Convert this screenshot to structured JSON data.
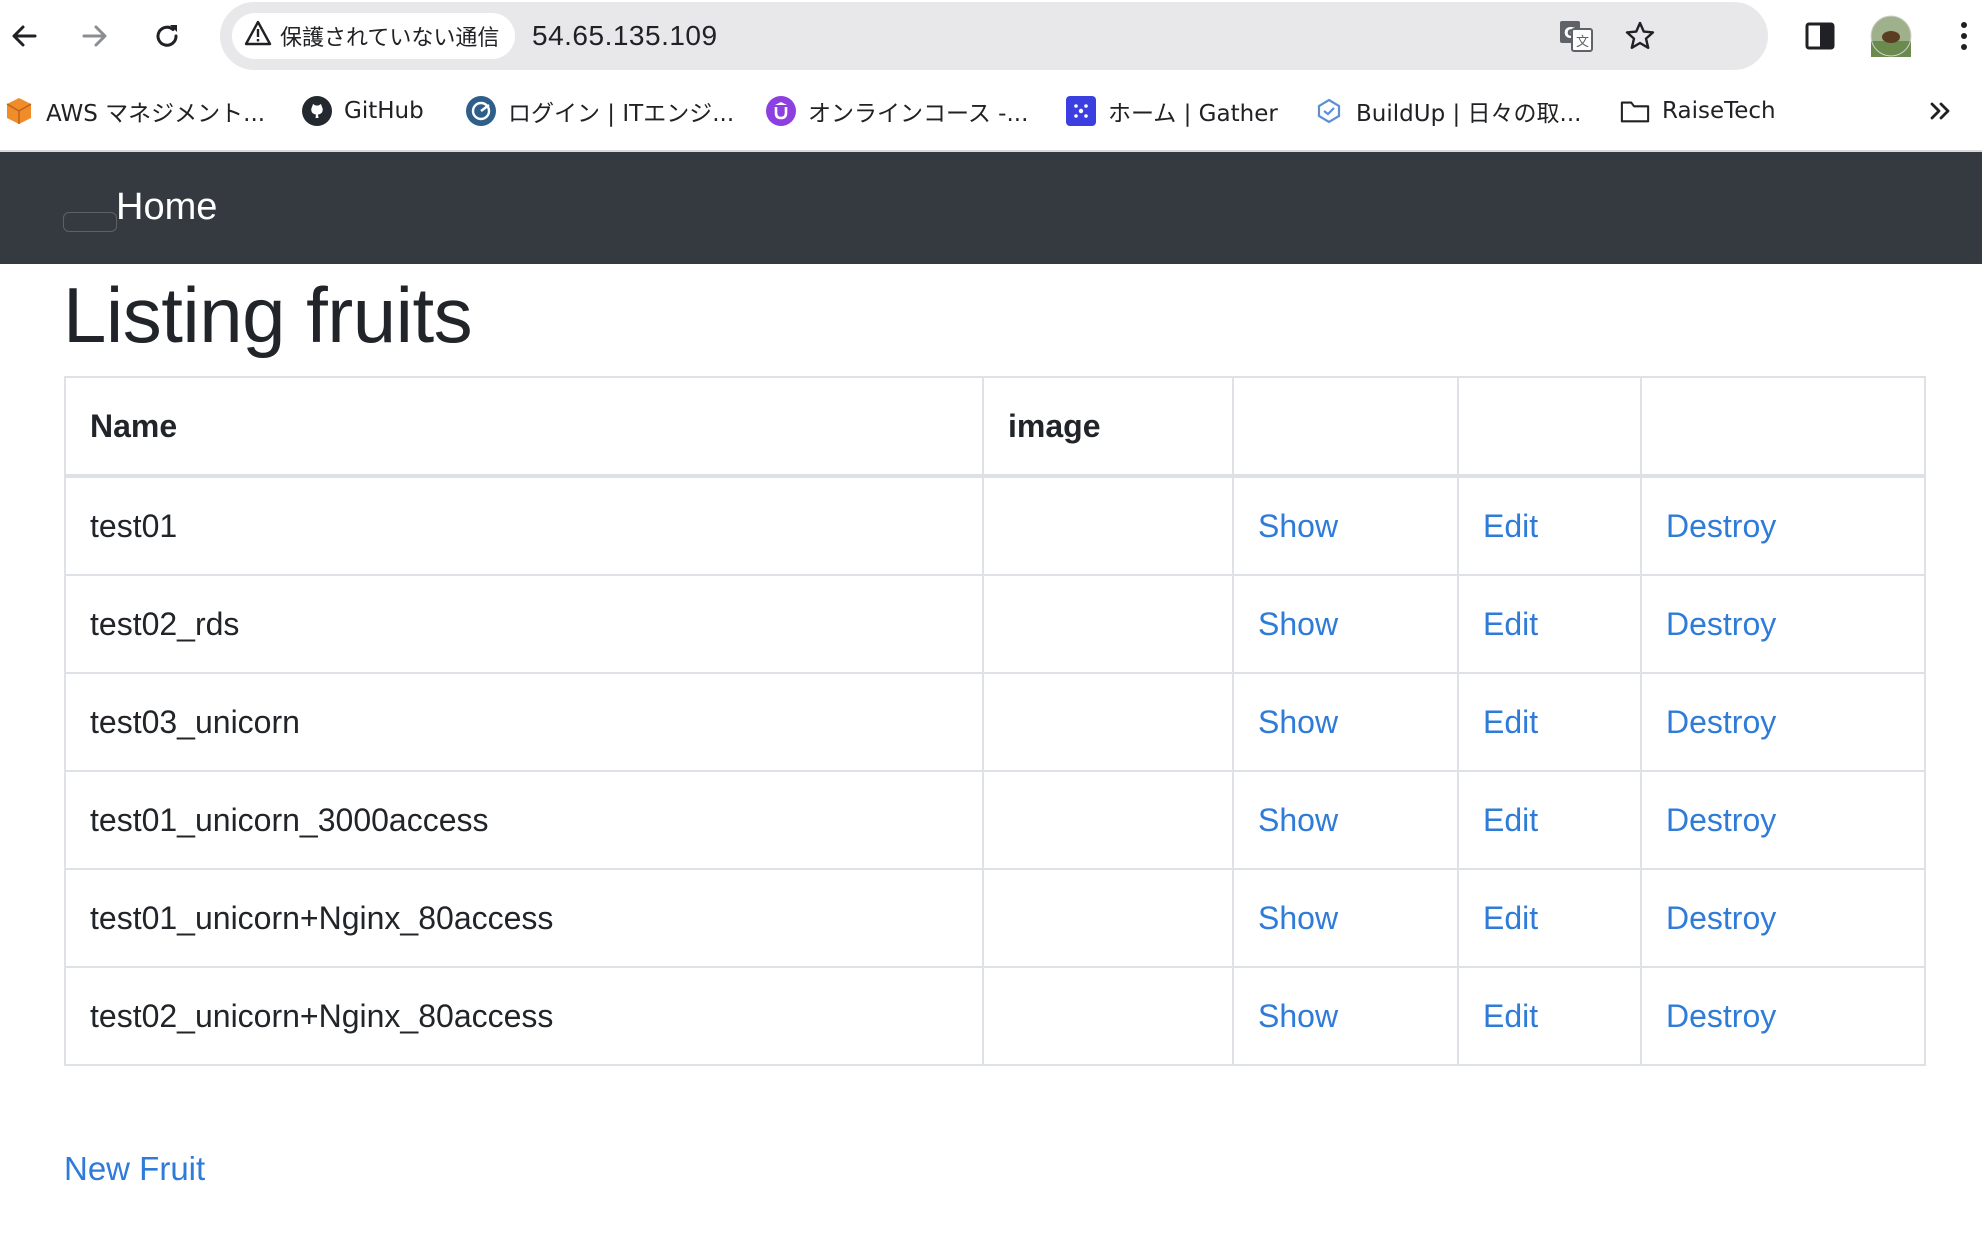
{
  "browser": {
    "security_label": "保護されていない通信",
    "url": "54.65.135.109"
  },
  "bookmarks": [
    {
      "label": "AWS マネジメント...",
      "icon": "aws-cube-icon"
    },
    {
      "label": "GitHub",
      "icon": "github-icon"
    },
    {
      "label": "ログイン | ITエンジ...",
      "icon": "circle-arrow-icon"
    },
    {
      "label": "オンラインコース -...",
      "icon": "udemy-icon"
    },
    {
      "label": "ホーム | Gather",
      "icon": "gather-icon"
    },
    {
      "label": "BuildUp | 日々の取...",
      "icon": "buildup-icon"
    },
    {
      "label": "RaiseTech",
      "icon": "folder-icon"
    }
  ],
  "navbar": {
    "brand": "Home"
  },
  "page": {
    "title": "Listing fruits"
  },
  "table": {
    "headers": [
      "Name",
      "image",
      "",
      "",
      ""
    ],
    "rows": [
      {
        "name": "test01",
        "image": "",
        "show": "Show",
        "edit": "Edit",
        "destroy": "Destroy"
      },
      {
        "name": "test02_rds",
        "image": "",
        "show": "Show",
        "edit": "Edit",
        "destroy": "Destroy"
      },
      {
        "name": "test03_unicorn",
        "image": "",
        "show": "Show",
        "edit": "Edit",
        "destroy": "Destroy"
      },
      {
        "name": "test01_unicorn_3000access",
        "image": "",
        "show": "Show",
        "edit": "Edit",
        "destroy": "Destroy"
      },
      {
        "name": "test01_unicorn+Nginx_80access",
        "image": "",
        "show": "Show",
        "edit": "Edit",
        "destroy": "Destroy"
      },
      {
        "name": "test02_unicorn+Nginx_80access",
        "image": "",
        "show": "Show",
        "edit": "Edit",
        "destroy": "Destroy"
      }
    ]
  },
  "footer_link": "New Fruit",
  "colors": {
    "navbar": "#343a40",
    "link": "#2f7bd8",
    "chrome_omnibox": "#e8e8ea"
  }
}
